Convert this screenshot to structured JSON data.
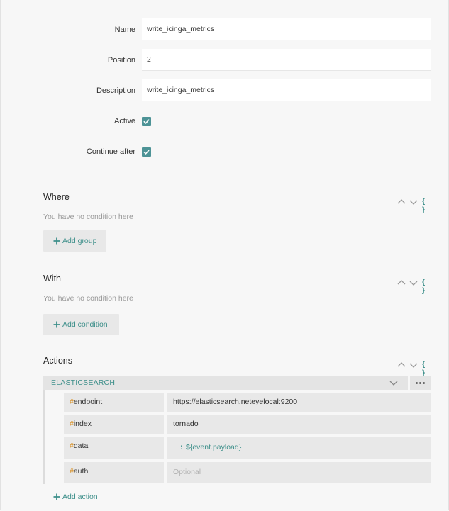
{
  "form": {
    "name": {
      "label": "Name",
      "value": "write_icinga_metrics"
    },
    "position": {
      "label": "Position",
      "value": "2"
    },
    "description": {
      "label": "Description",
      "value": "write_icinga_metrics"
    },
    "active": {
      "label": "Active",
      "checked": true
    },
    "continue_after": {
      "label": "Continue after",
      "checked": true
    }
  },
  "where": {
    "title": "Where",
    "empty_text": "You have no condition here",
    "add_label": "Add group",
    "json_toggle": "{ }"
  },
  "with": {
    "title": "With",
    "empty_text": "You have no condition here",
    "add_label": "Add condition",
    "json_toggle": "{ }"
  },
  "actions": {
    "title": "Actions",
    "json_toggle": "{ }",
    "items": [
      {
        "type": "ELASTICSEARCH",
        "params": [
          {
            "hash": "#",
            "key": "endpoint",
            "value": "https://elasticsearch.neteyelocal:9200"
          },
          {
            "hash": "#",
            "key": "index",
            "value": "tornado"
          },
          {
            "hash": "#",
            "key": "data",
            "colon": ":",
            "value": "${event.payload}"
          },
          {
            "hash": "#",
            "key": "auth",
            "placeholder": "Optional"
          }
        ]
      }
    ],
    "add_label": "Add action"
  },
  "icons": {
    "checkbox": "check-icon",
    "up": "chevron-up-icon",
    "down": "chevron-down-icon",
    "plus": "plus-icon",
    "more": "more-horizontal-icon"
  },
  "colors": {
    "accent": "#3d8f8a",
    "checkbox": "#4d9396",
    "hash": "#d8922a",
    "focus_underline": "#5aa57c"
  }
}
